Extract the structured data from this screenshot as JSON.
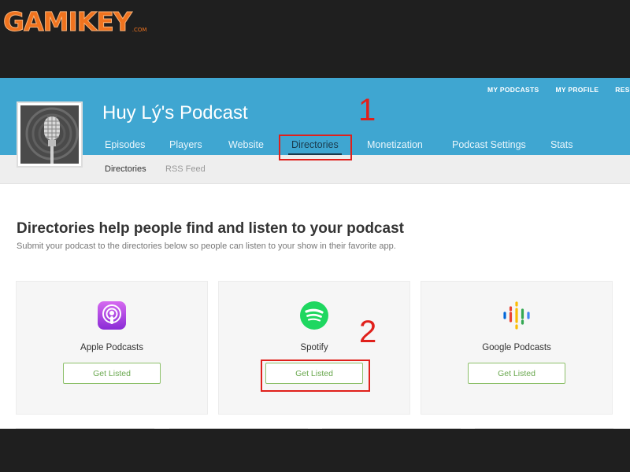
{
  "watermark": {
    "brand": "GAMIKEY",
    "suffix": ".COM"
  },
  "header": {
    "top_nav": [
      "MY PODCASTS",
      "MY PROFILE",
      "RESOU"
    ],
    "podcast_title": "Huy Lý's Podcast",
    "avatar_icon": "microphone-icon"
  },
  "tabs": [
    {
      "label": "Episodes"
    },
    {
      "label": "Players"
    },
    {
      "label": "Website"
    },
    {
      "label": "Directories"
    },
    {
      "label": "Monetization"
    },
    {
      "label": "Podcast Settings"
    },
    {
      "label": "Stats"
    }
  ],
  "active_tab": "Directories",
  "subnav": [
    "Directories",
    "RSS Feed"
  ],
  "main": {
    "heading": "Directories help people find and listen to your podcast",
    "subheading": "Submit your podcast to the directories below so people can listen to your show in their favorite app."
  },
  "directories": [
    {
      "name": "Apple Podcasts",
      "button": "Get Listed",
      "icon": "apple-podcasts-icon"
    },
    {
      "name": "Spotify",
      "button": "Get Listed",
      "icon": "spotify-icon"
    },
    {
      "name": "Google Podcasts",
      "button": "Get Listed",
      "icon": "google-podcasts-icon"
    }
  ],
  "annotations": [
    "1",
    "2"
  ],
  "colors": {
    "header": "#3fa6d1",
    "annotation": "#e0201b",
    "button": "#6aa84f",
    "watermark": "#f0731e"
  }
}
